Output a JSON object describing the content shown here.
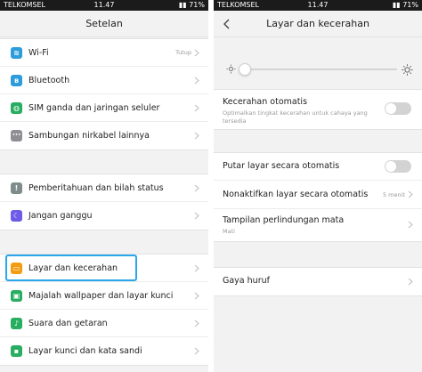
{
  "status_bar": {
    "carrier": "TELKOMSEL",
    "time": "11.47",
    "battery": "71%"
  },
  "left": {
    "title": "Setelan",
    "group1": [
      {
        "label": "Wi-Fi",
        "value": "Tutup",
        "icon": "wifi-icon",
        "color": "#2d9cdb"
      },
      {
        "label": "Bluetooth",
        "value": "",
        "icon": "bluetooth-icon",
        "color": "#2d9cdb"
      },
      {
        "label": "SIM ganda dan jaringan seluler",
        "value": "",
        "icon": "globe-icon",
        "color": "#27ae60"
      },
      {
        "label": "Sambungan nirkabel lainnya",
        "value": "",
        "icon": "dots-icon",
        "color": "#8e8e93"
      }
    ],
    "group2": [
      {
        "label": "Pemberitahuan dan bilah status",
        "icon": "notification-icon",
        "color": "#7f8c8d"
      },
      {
        "label": "Jangan ganggu",
        "icon": "moon-icon",
        "color": "#6c5ce7"
      }
    ],
    "group3": [
      {
        "label": "Layar dan kecerahan",
        "icon": "display-icon",
        "color": "#f39c12"
      },
      {
        "label": "Majalah wallpaper dan layar kunci",
        "icon": "wallpaper-icon",
        "color": "#27ae60"
      },
      {
        "label": "Suara dan getaran",
        "icon": "sound-icon",
        "color": "#27ae60"
      },
      {
        "label": "Layar kunci dan kata sandi",
        "icon": "lock-icon",
        "color": "#27ae60"
      }
    ]
  },
  "right": {
    "title": "Layar dan kecerahan",
    "brightness_level": 0.0,
    "auto_brightness": {
      "label": "Kecerahan otomatis",
      "sub": "Optimalkan tingkat kecerahan untuk cahaya yang tersedia",
      "on": false
    },
    "auto_rotate": {
      "label": "Putar layar secara otomatis",
      "on": false
    },
    "sleep": {
      "label": "Nonaktifkan layar secara otomatis",
      "value": "5 menit"
    },
    "eye_protection": {
      "label": "Tampilan perlindungan mata",
      "sub": "Mati"
    },
    "font": {
      "label": "Gaya huruf"
    }
  }
}
